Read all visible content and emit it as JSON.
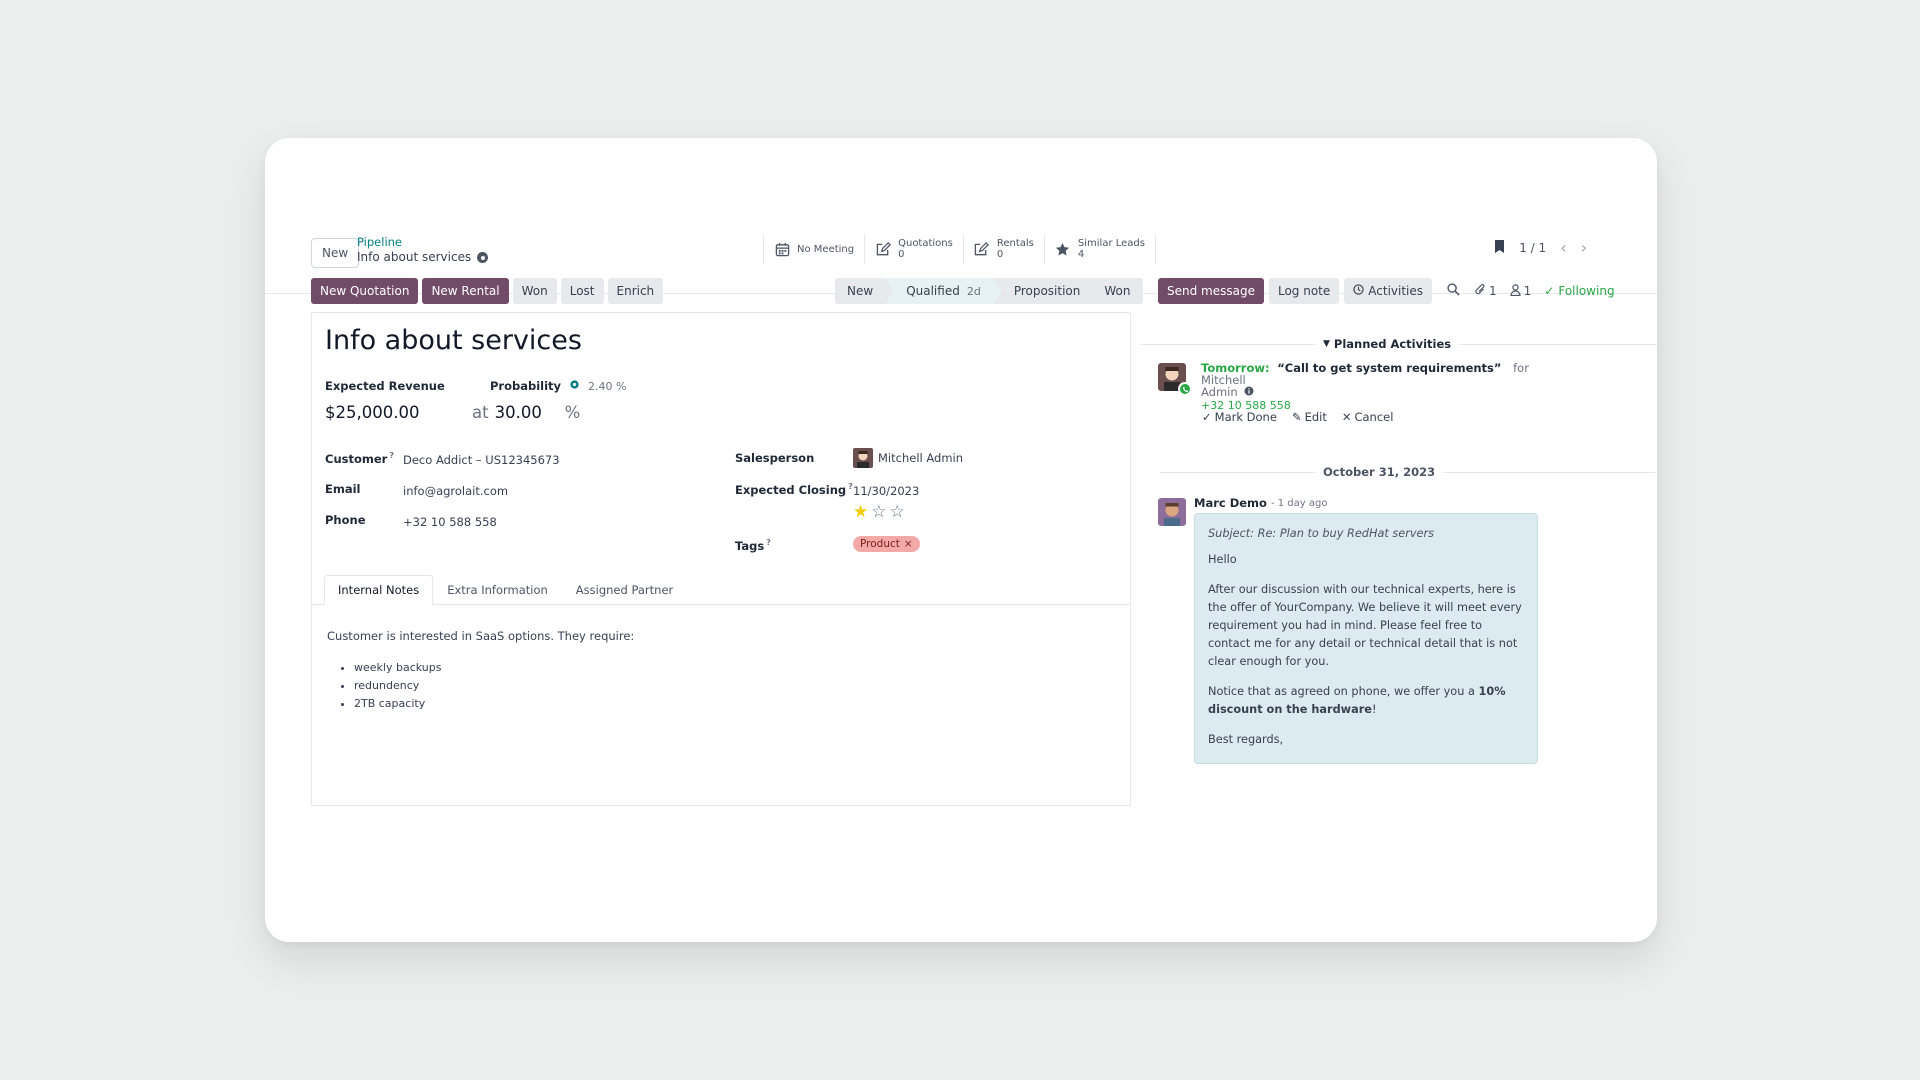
{
  "header": {
    "new_label": "New",
    "breadcrumb_parent": "Pipeline",
    "breadcrumb_current": "Info about services",
    "pager": "1 / 1"
  },
  "smart_buttons": [
    {
      "label": "No Meeting",
      "count": "",
      "icon": "calendar-icon"
    },
    {
      "label": "Quotations",
      "count": "0",
      "icon": "pencil-square-icon"
    },
    {
      "label": "Rentals",
      "count": "0",
      "icon": "pencil-square-icon"
    },
    {
      "label": "Similar Leads",
      "count": "4",
      "icon": "star-icon"
    }
  ],
  "actions": {
    "new_quotation": "New Quotation",
    "new_rental": "New Rental",
    "won": "Won",
    "lost": "Lost",
    "enrich": "Enrich"
  },
  "stages": {
    "new": "New",
    "qualified": "Qualified",
    "qualified_duration": "2d",
    "proposition": "Proposition",
    "won": "Won"
  },
  "form": {
    "title": "Info about services",
    "expected_revenue_label": "Expected Revenue",
    "expected_revenue": "$25,000.00",
    "probability_label": "Probability",
    "probability_auto": "2.40 %",
    "at_label": "at",
    "probability": "30.00",
    "percent": "%",
    "customer_label": "Customer",
    "customer": "Deco Addict – US12345673",
    "email_label": "Email",
    "email": "info@agrolait.com",
    "phone_label": "Phone",
    "phone": "+32 10 588 558",
    "salesperson_label": "Salesperson",
    "salesperson": "Mitchell Admin",
    "expected_closing_label": "Expected Closing",
    "expected_closing": "11/30/2023",
    "priority_stars": 1,
    "tags_label": "Tags",
    "tag": "Product",
    "help_mark": "?"
  },
  "tabs": [
    "Internal Notes",
    "Extra Information",
    "Assigned Partner"
  ],
  "notes": {
    "intro": "Customer is interested in SaaS options. They require:",
    "items": [
      "weekly backups",
      "redundency",
      "2TB capacity"
    ]
  },
  "chatter": {
    "send_message": "Send message",
    "log_note": "Log note",
    "activities": "Activities",
    "attachments_count": "1",
    "followers_count": "1",
    "following": "Following",
    "planned_activities": "Planned Activities",
    "activity_when": "Tomorrow:",
    "activity_title": "“Call to get system requirements”",
    "activity_for": "for Mitchell",
    "activity_for_2": "Admin",
    "activity_phone": "+32 10 588 558",
    "mark_done": "Mark Done",
    "edit": "Edit",
    "cancel": "Cancel",
    "date_separator": "October 31, 2023",
    "author": "Marc Demo",
    "time_ago": "- 1 day ago",
    "subject": "Subject: Re: Plan to buy RedHat servers",
    "p1": "Hello",
    "p2": "After our discussion with our technical experts, here is the offer of YourCompany. We believe it will meet every requirement you had in mind. Please feel free to contact me for any detail or technical detail that is not clear enough for you.",
    "p3_a": "Notice that as agreed on phone, we offer you a ",
    "p3_b": "10% discount on the hardware",
    "p3_c": "!",
    "p4": "Best regards,"
  },
  "colors": {
    "primary": "#714b67",
    "link": "#017e84",
    "success": "#28a745",
    "tag_bg": "#f4a9a9",
    "message_bg": "#dcebef",
    "star": "#f3cc00"
  }
}
